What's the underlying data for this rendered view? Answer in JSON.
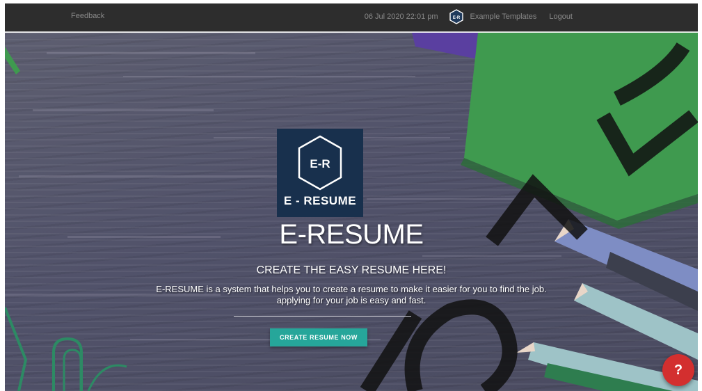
{
  "navbar": {
    "feedback_label": "Feedback",
    "datetime": "06 Jul 2020 22:01 pm",
    "logo_text": "E-R",
    "example_templates_label": "Example Templates",
    "logout_label": "Logout"
  },
  "hero": {
    "logo_mark": "E-R",
    "logo_text": "E - RESUME",
    "title": "E-RESUME",
    "subtitle": "CREATE THE EASY RESUME HERE!",
    "description_line1": "E-RESUME is a system that helps you to create a resume to make it easier for you to find the job.",
    "description_line2": "applying for your job is easy and fast.",
    "cta_label": "CREATE RESUME NOW",
    "help_label": "?"
  },
  "colors": {
    "navbar_bg": "#2d2d2d",
    "logo_bg": "#18304d",
    "cta_bg": "#26a69a",
    "help_bg": "#d32f2f",
    "sticky_note": "#3f9a4f"
  },
  "icons": {
    "nav_logo": "hexagon-logo-icon",
    "hero_logo": "hexagon-logo-icon",
    "help": "question-mark-icon"
  }
}
